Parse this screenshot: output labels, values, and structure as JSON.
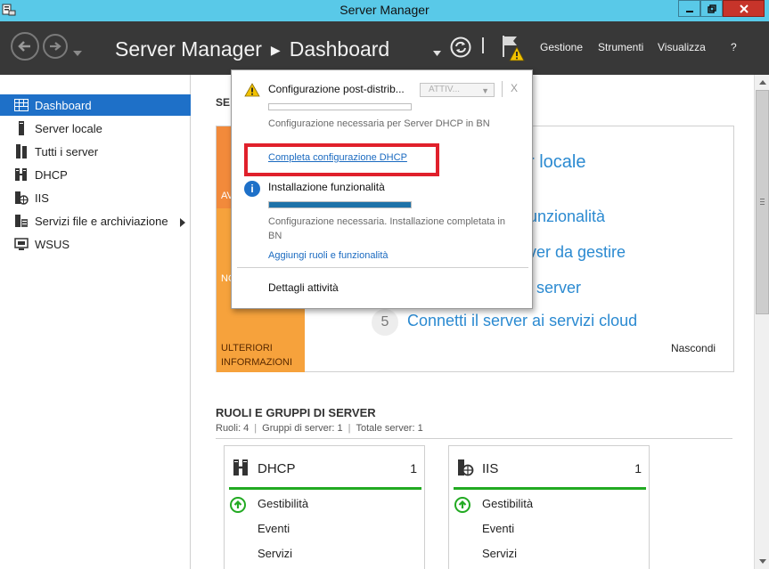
{
  "window": {
    "title": "Server Manager",
    "controls": {
      "minimize": "–",
      "maximize": "▫",
      "close": "✕"
    }
  },
  "header": {
    "app_name": "Server Manager",
    "page": "Dashboard",
    "menus": [
      "Gestione",
      "Strumenti",
      "Visualizza",
      "?"
    ]
  },
  "sidebar": {
    "items": [
      {
        "label": "Dashboard",
        "icon": "dashboard-icon",
        "active": true
      },
      {
        "label": "Server locale",
        "icon": "server-icon"
      },
      {
        "label": "Tutti i server",
        "icon": "servers-icon"
      },
      {
        "label": "DHCP",
        "icon": "dhcp-icon"
      },
      {
        "label": "IIS",
        "icon": "iis-icon"
      },
      {
        "label": "Servizi file e archiviazione",
        "icon": "file-services-icon",
        "has_submenu": true
      },
      {
        "label": "WSUS",
        "icon": "wsus-icon"
      }
    ]
  },
  "main": {
    "section_heading_fragment": "SE",
    "quick_start": {
      "tile_fragments": [
        "AV",
        "NO"
      ],
      "more_info": "ULTERIORI INFORMAZIONI",
      "steps": [
        {
          "text": "r locale"
        },
        {
          "text": "unzionalità"
        },
        {
          "text": "ver da gestire"
        },
        {
          "text": "i server"
        },
        {
          "num": "5",
          "text": "Connetti il server ai servizi cloud"
        }
      ],
      "hide": "Nascondi"
    },
    "roles": {
      "heading": "RUOLI E GRUPPI DI SERVER",
      "summary": [
        "Ruoli: 4",
        "Gruppi di server: 1",
        "Totale server: 1"
      ],
      "cards": [
        {
          "name": "DHCP",
          "count": "1",
          "rows": [
            "Gestibilità",
            "Eventi",
            "Servizi"
          ],
          "accent": "#22aa22"
        },
        {
          "name": "IIS",
          "count": "1",
          "rows": [
            "Gestibilità",
            "Eventi",
            "Servizi"
          ],
          "accent": "#22aa22"
        }
      ]
    }
  },
  "notifications": {
    "task1": {
      "title": "Configurazione post-distrib...",
      "task_select": "ATTIV...",
      "close": "X",
      "progress": 0,
      "description": "Configurazione necessaria per Server DHCP in BN",
      "link": "Completa configurazione DHCP"
    },
    "task2": {
      "title": "Installazione funzionalità",
      "progress": 1,
      "description": "Configurazione necessaria. Installazione completata in BN",
      "link": "Aggiungi ruoli e funzionalità"
    },
    "details": "Dettagli attività",
    "colors": {
      "highlight": "#e0202b",
      "link": "#1a6ac0",
      "warning": "#f2c200"
    }
  }
}
